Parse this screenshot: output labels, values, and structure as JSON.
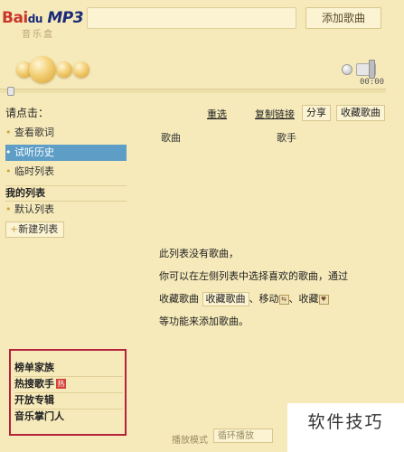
{
  "header": {
    "logo_main": "Bai",
    "logo_du": "du",
    "logo_mp3": "MP3",
    "logo_sub": "音乐盒",
    "add_song_button": "添加歌曲"
  },
  "player": {
    "time": "00:00"
  },
  "sidebar": {
    "prompt": "请点击：",
    "items": [
      {
        "label": "查看歌词",
        "active": false
      },
      {
        "label": "试听历史",
        "active": true
      },
      {
        "label": "临时列表",
        "active": false
      }
    ],
    "my_lists_title": "我的列表",
    "default_list": "默认列表",
    "new_list": "新建列表",
    "bottom_items": [
      {
        "label": "榜单家族",
        "hot": false
      },
      {
        "label": "热搜歌手",
        "hot": true
      },
      {
        "label": "开放专辑",
        "hot": false
      },
      {
        "label": "音乐掌门人",
        "hot": false
      }
    ],
    "hot_badge": "热"
  },
  "toolbar": {
    "reselect": "重选",
    "copy_link": "复制链接",
    "share": "分享",
    "collect": "收藏歌曲"
  },
  "columns": {
    "song": "歌曲",
    "singer": "歌手"
  },
  "empty_state": {
    "line1": "此列表没有歌曲，",
    "line2": "你可以在左侧列表中选择喜欢的歌曲，通过",
    "line3_a": "收藏歌曲",
    "line3_box": "收藏歌曲",
    "line3_b": "、移动",
    "line3_c": "、收藏",
    "line4": "等功能来添加歌曲。"
  },
  "footer": {
    "mode_label": "播放模式",
    "mode_value": "循环播放"
  },
  "watermark": "软件技巧",
  "colors": {
    "background": "#f6eaba",
    "active_item": "#5e9ec6",
    "highlight_border": "#b5223a",
    "logo_red": "#c8352b"
  }
}
